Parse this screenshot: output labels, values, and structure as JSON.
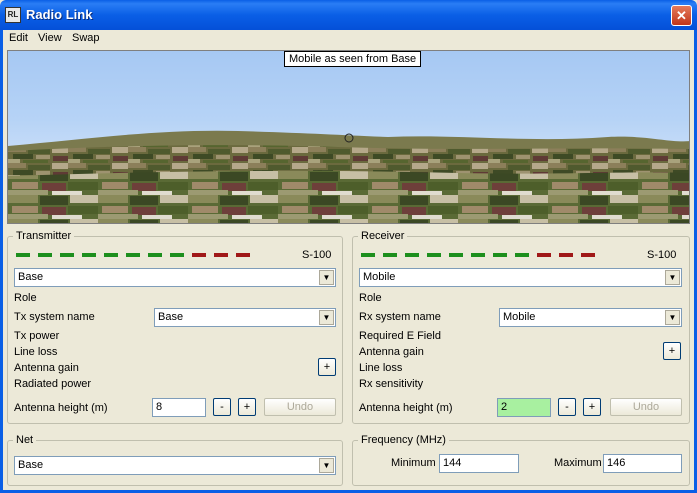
{
  "window": {
    "title": "Radio Link",
    "close_glyph": "✕"
  },
  "menu": [
    "Edit",
    "View",
    "Swap"
  ],
  "view": {
    "label": "Mobile as seen from Base"
  },
  "transmitter": {
    "title": "Transmitter",
    "meter_label": "S-100",
    "unit": "Base",
    "role_label": "Role",
    "system_label": "Tx system name",
    "system_value": "Base",
    "fields": [
      "Tx power",
      "Line loss",
      "Antenna gain",
      "Radiated power"
    ],
    "antenna_height_label": "Antenna height (m)",
    "antenna_height_value": "8",
    "plus": "+",
    "minus": "-",
    "undo": "Undo"
  },
  "receiver": {
    "title": "Receiver",
    "meter_label": "S-100",
    "unit": "Mobile",
    "role_label": "Role",
    "system_label": "Rx system name",
    "system_value": "Mobile",
    "fields": [
      "Required E Field",
      "Antenna gain",
      "Line loss",
      "Rx sensitivity"
    ],
    "antenna_height_label": "Antenna height (m)",
    "antenna_height_value": "2",
    "plus": "+",
    "minus": "-",
    "undo": "Undo"
  },
  "net": {
    "title": "Net",
    "value": "Base"
  },
  "frequency": {
    "title": "Frequency (MHz)",
    "min_label": "Minimum",
    "min_value": "144",
    "max_label": "Maximum",
    "max_value": "146"
  },
  "colors": {
    "meter_green": "#1d8f1d",
    "meter_red": "#a01818",
    "highlight_field": "#a8f0a0",
    "titlebar": "#0a5fe6"
  }
}
